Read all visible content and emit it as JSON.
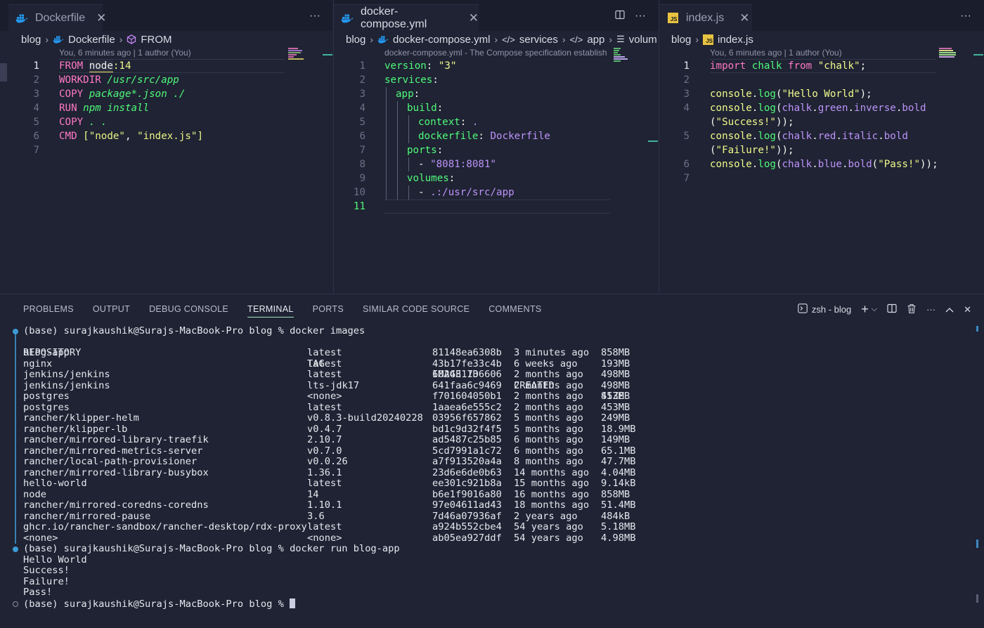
{
  "editors": [
    {
      "tab": {
        "label": "Dockerfile",
        "icon": "docker-icon"
      },
      "breadcrumb": [
        "blog",
        "Dockerfile",
        "FROM"
      ],
      "blame": "You, 6 minutes ago | 1 author (You)",
      "active_line": 1,
      "line_numbers": [
        "1",
        "2",
        "3",
        "4",
        "5",
        "6",
        "7"
      ]
    },
    {
      "tab": {
        "label": "docker-compose.yml",
        "icon": "docker-icon"
      },
      "breadcrumb": [
        "blog",
        "docker-compose.yml",
        "services",
        "app",
        "volum"
      ],
      "blame": "docker-compose.yml - The Compose specification establish",
      "active_line": 11,
      "line_numbers": [
        "1",
        "2",
        "3",
        "4",
        "5",
        "6",
        "7",
        "8",
        "9",
        "10",
        "11"
      ]
    },
    {
      "tab": {
        "label": "index.js",
        "icon": "js-icon"
      },
      "breadcrumb": [
        "blog",
        "index.js"
      ],
      "blame": "You, 6 minutes ago | 1 author (You)",
      "active_line": 1,
      "line_numbers": [
        "1",
        "2",
        "3",
        "4",
        "",
        "5",
        "",
        "6",
        "7"
      ]
    }
  ],
  "dockerfile": {
    "l1": [
      "FROM",
      "node",
      ":14"
    ],
    "l2": [
      "WORKDIR",
      "/usr/src/app"
    ],
    "l3": [
      "COPY",
      "package*.json ./"
    ],
    "l4": [
      "RUN",
      "npm install"
    ],
    "l5": [
      "COPY",
      ". ."
    ],
    "l6": [
      "CMD",
      "[",
      "\"node\"",
      ", ",
      "\"index.js\"",
      "]"
    ]
  },
  "compose": {
    "l1": [
      "version",
      ": ",
      "\"3\""
    ],
    "l2": [
      "services",
      ":"
    ],
    "l3": [
      "app",
      ":"
    ],
    "l4": [
      "build",
      ":"
    ],
    "l5": [
      "context",
      ": ",
      "."
    ],
    "l6": [
      "dockerfile",
      ": ",
      "Dockerfile"
    ],
    "l7": [
      "ports",
      ":"
    ],
    "l8": [
      "- ",
      "\"8081:8081\""
    ],
    "l9": [
      "volumes",
      ":"
    ],
    "l10": [
      "- ",
      ".:/usr/src/app"
    ]
  },
  "indexjs": {
    "l1": [
      "import",
      " chalk ",
      "from",
      " ",
      "\"chalk\"",
      ";"
    ],
    "l3": [
      "console",
      ".",
      "log",
      "(",
      "\"Hello World\"",
      ");"
    ],
    "l4a": [
      "console",
      ".",
      "log",
      "(",
      "chalk",
      ".",
      "green",
      ".",
      "inverse",
      ".",
      "bold"
    ],
    "l4b": [
      "(",
      "\"Success!\"",
      "));"
    ],
    "l5a": [
      "console",
      ".",
      "log",
      "(",
      "chalk",
      ".",
      "red",
      ".",
      "italic",
      ".",
      "bold"
    ],
    "l5b": [
      "(",
      "\"Failure!\"",
      "));"
    ],
    "l6": [
      "console",
      ".",
      "log",
      "(",
      "chalk",
      ".",
      "blue",
      ".",
      "bold",
      "(",
      "\"Pass!\"",
      "));"
    ]
  },
  "panel": {
    "tabs": [
      "PROBLEMS",
      "OUTPUT",
      "DEBUG CONSOLE",
      "TERMINAL",
      "PORTS",
      "SIMILAR CODE SOURCE",
      "COMMENTS"
    ],
    "active_tab": "TERMINAL",
    "shell_label": "zsh - blog"
  },
  "terminal": {
    "prompt1": "(base) surajkaushik@Surajs-MacBook-Pro blog % docker images",
    "headers": [
      "REPOSITORY",
      "TAG",
      "IMAGE ID",
      "CREATED",
      "SIZE"
    ],
    "rows": [
      [
        "blog-app",
        "latest",
        "81148ea6308b",
        "3 minutes ago",
        "858MB"
      ],
      [
        "nginx",
        "latest",
        "43b17fe33c4b",
        "6 weeks ago",
        "193MB"
      ],
      [
        "jenkins/jenkins",
        "latest",
        "602431736606",
        "2 months ago",
        "498MB"
      ],
      [
        "jenkins/jenkins",
        "lts-jdk17",
        "641faa6c9469",
        "2 months ago",
        "498MB"
      ],
      [
        "postgres",
        "<none>",
        "f701604050b1",
        "2 months ago",
        "453MB"
      ],
      [
        "postgres",
        "latest",
        "1aaea6e555c2",
        "2 months ago",
        "453MB"
      ],
      [
        "rancher/klipper-helm",
        "v0.8.3-build20240228",
        "03956f657862",
        "5 months ago",
        "249MB"
      ],
      [
        "rancher/klipper-lb",
        "v0.4.7",
        "bd1c9d32f4f5",
        "5 months ago",
        "18.9MB"
      ],
      [
        "rancher/mirrored-library-traefik",
        "2.10.7",
        "ad5487c25b85",
        "6 months ago",
        "149MB"
      ],
      [
        "rancher/mirrored-metrics-server",
        "v0.7.0",
        "5cd7991a1c72",
        "6 months ago",
        "65.1MB"
      ],
      [
        "rancher/local-path-provisioner",
        "v0.0.26",
        "a7f913520a4a",
        "8 months ago",
        "47.7MB"
      ],
      [
        "rancher/mirrored-library-busybox",
        "1.36.1",
        "23d6e6de0b63",
        "14 months ago",
        "4.04MB"
      ],
      [
        "hello-world",
        "latest",
        "ee301c921b8a",
        "15 months ago",
        "9.14kB"
      ],
      [
        "node",
        "14",
        "b6e1f9016a80",
        "16 months ago",
        "858MB"
      ],
      [
        "rancher/mirrored-coredns-coredns",
        "1.10.1",
        "97e04611ad43",
        "18 months ago",
        "51.4MB"
      ],
      [
        "rancher/mirrored-pause",
        "3.6",
        "7d46a07936af",
        "2 years ago",
        "484kB"
      ],
      [
        "ghcr.io/rancher-sandbox/rancher-desktop/rdx-proxy",
        "latest",
        "a924b552cbe4",
        "54 years ago",
        "5.18MB"
      ],
      [
        "<none>",
        "<none>",
        "ab05ea927ddf",
        "54 years ago",
        "4.98MB"
      ]
    ],
    "prompt2": "(base) surajkaushik@Surajs-MacBook-Pro blog % docker run blog-app",
    "output": [
      "Hello World",
      "Success!",
      "Failure!",
      "Pass!"
    ],
    "prompt3": "(base) surajkaushik@Surajs-MacBook-Pro blog % "
  }
}
